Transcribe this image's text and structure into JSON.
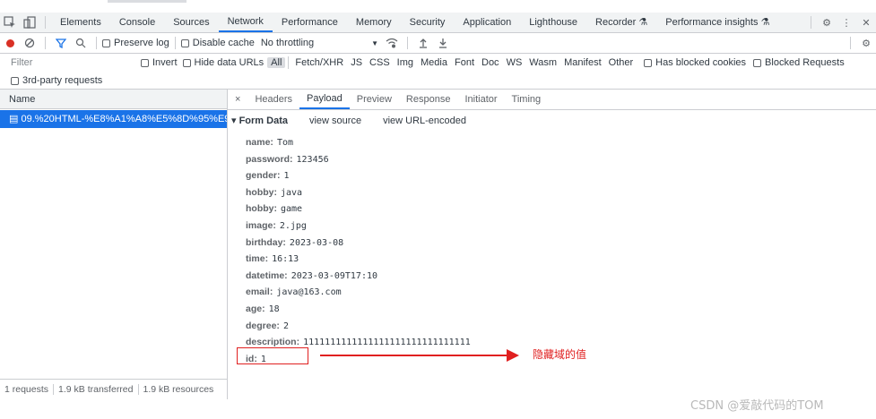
{
  "panel_tabs": [
    "Elements",
    "Console",
    "Sources",
    "Network",
    "Performance",
    "Memory",
    "Security",
    "Application",
    "Lighthouse",
    "Recorder",
    "Performance insights"
  ],
  "toolbar": {
    "preserve_log": "Preserve log",
    "disable_cache": "Disable cache",
    "throttling": "No throttling"
  },
  "filter": {
    "placeholder": "Filter",
    "invert": "Invert",
    "hide_data_urls": "Hide data URLs",
    "types": [
      "All",
      "Fetch/XHR",
      "JS",
      "CSS",
      "Img",
      "Media",
      "Font",
      "Doc",
      "WS",
      "Wasm",
      "Manifest",
      "Other"
    ],
    "has_blocked_cookies": "Has blocked cookies",
    "blocked_requests": "Blocked Requests",
    "third_party": "3rd-party requests"
  },
  "request_list": {
    "header": "Name",
    "item": "09.%20HTML-%E8%A1%A8%E5%8D%95%E9%..."
  },
  "status_bar": {
    "requests": "1 requests",
    "transferred": "1.9 kB transferred",
    "resources": "1.9 kB resources"
  },
  "detail_tabs": [
    "×",
    "Headers",
    "Payload",
    "Preview",
    "Response",
    "Initiator",
    "Timing"
  ],
  "form_data": {
    "title": "▾ Form Data",
    "view_source": "view source",
    "view_url_encoded": "view URL-encoded",
    "fields": [
      {
        "key": "name:",
        "value": "Tom"
      },
      {
        "key": "password:",
        "value": "123456"
      },
      {
        "key": "gender:",
        "value": "1"
      },
      {
        "key": "hobby:",
        "value": "java"
      },
      {
        "key": "hobby:",
        "value": "game"
      },
      {
        "key": "image:",
        "value": "2.jpg"
      },
      {
        "key": "birthday:",
        "value": "2023-03-08"
      },
      {
        "key": "time:",
        "value": "16:13"
      },
      {
        "key": "datetime:",
        "value": "2023-03-09T17:10"
      },
      {
        "key": "email:",
        "value": "java@163.com"
      },
      {
        "key": "age:",
        "value": "18"
      },
      {
        "key": "degree:",
        "value": "2"
      },
      {
        "key": "description:",
        "value": "1111111111111111111111111111111"
      },
      {
        "key": "id:",
        "value": "1"
      }
    ]
  },
  "annotation": "隐藏域的值",
  "watermark": "CSDN @爱敲代码的TOM",
  "colors": {
    "accent": "#1a73e8",
    "annotation": "#e02020",
    "record": "#d93025"
  }
}
